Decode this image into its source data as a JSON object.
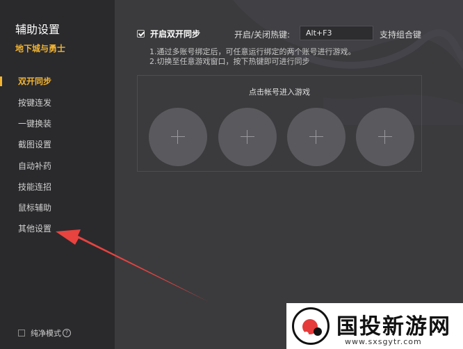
{
  "sidebar": {
    "app_title": "辅助设置",
    "game_name": "地下城与勇士",
    "items": [
      {
        "label": "双开同步",
        "active": true
      },
      {
        "label": "按键连发"
      },
      {
        "label": "一键换装"
      },
      {
        "label": "截图设置"
      },
      {
        "label": "自动补药"
      },
      {
        "label": "技能连招"
      },
      {
        "label": "鼠标辅助"
      },
      {
        "label": "其他设置"
      }
    ],
    "pure_mode_label": "纯净模式",
    "help_glyph": "?"
  },
  "main": {
    "sync_label": "开启双开同步",
    "sync_checked": true,
    "hotkey_label": "开启/关闭热键:",
    "hotkey_value": "Alt+F3",
    "hotkey_hint": "支持组合键",
    "instructions": [
      "1.通过多账号绑定后，可任意运行绑定的两个账号进行游戏。",
      "2.切换至任意游戏窗口，按下热键即可进行同步"
    ],
    "panel_title": "点击帐号进入游戏",
    "slots": [
      {
        "icon": "plus-icon"
      },
      {
        "icon": "plus-icon"
      },
      {
        "icon": "plus-icon"
      },
      {
        "icon": "plus-icon"
      }
    ]
  },
  "annotation": {
    "arrow_color": "#e8433f"
  },
  "watermark": {
    "text": "国投新游网",
    "url": "www.sxsgytr.com"
  },
  "colors": {
    "accent": "#f2b431",
    "sidebar_bg": "#2a2a2d",
    "main_bg": "#3b3b3e",
    "slot_bg": "#5a5a5e"
  }
}
